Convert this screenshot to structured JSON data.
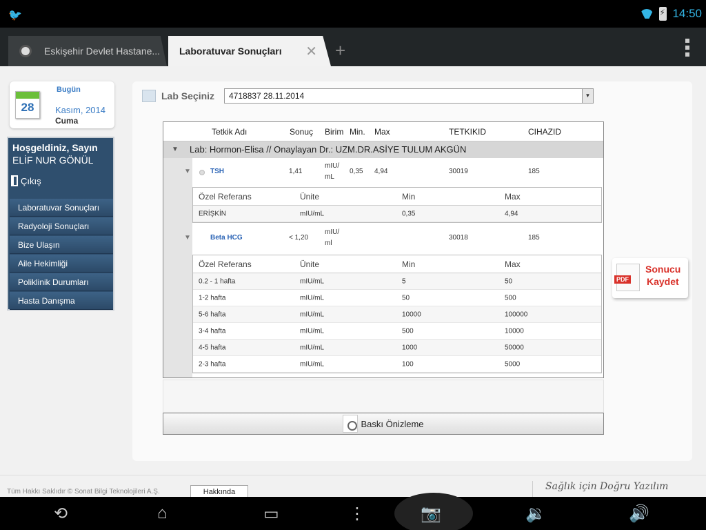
{
  "status": {
    "time": "14:50"
  },
  "browser": {
    "tabs": [
      {
        "label": "Eskişehir Devlet Hastane..."
      },
      {
        "label": "Laboratuvar Sonuçları"
      }
    ]
  },
  "date": {
    "today_label": "Bugün",
    "day_number": "28",
    "month_year": "Kasım, 2014",
    "weekday": "Cuma"
  },
  "sidebar": {
    "welcome": "Hoşgeldiniz, Sayın",
    "user": "ELİF NUR GÖNÜL",
    "logout": "Çıkış",
    "items": [
      {
        "label": "Laboratuvar Sonuçları"
      },
      {
        "label": "Radyoloji Sonuçları"
      },
      {
        "label": "Bize Ulaşın"
      },
      {
        "label": "Aile Hekimliği"
      },
      {
        "label": "Poliklinik Durumları"
      },
      {
        "label": "Hasta Danışma"
      }
    ]
  },
  "lab": {
    "select_label": "Lab Seçiniz",
    "selected": "4718837 28.11.2014"
  },
  "grid": {
    "headers": {
      "name": "Tetkik Adı",
      "result": "Sonuç",
      "unit": "Birim",
      "min": "Min.",
      "max": "Max",
      "id": "TETKIKID",
      "device": "CIHAZID"
    },
    "group": "Lab: Hormon-Elisa // Onaylayan Dr.: UZM.DR.ASİYE TULUM AKGÜN",
    "results": [
      {
        "name": "TSH",
        "result": "1,41",
        "unit1": "mIU/",
        "unit2": "mL",
        "min": "0,35",
        "max": "4,94",
        "id": "30019",
        "device": "185",
        "ref_headers": {
          "ref": "Özel Referans",
          "unit": "Ünite",
          "min": "Min",
          "max": "Max"
        },
        "refs": [
          {
            "ref": "ERİŞKİN",
            "unit": "mIU/mL",
            "min": "0,35",
            "max": "4,94"
          }
        ]
      },
      {
        "name": "Beta HCG",
        "result": "< 1,20",
        "unit1": "mIU/",
        "unit2": "ml",
        "min": "",
        "max": "",
        "id": "30018",
        "device": "185",
        "ref_headers": {
          "ref": "Özel Referans",
          "unit": "Ünite",
          "min": "Min",
          "max": "Max"
        },
        "refs": [
          {
            "ref": "0.2 - 1 hafta",
            "unit": "mIU/mL",
            "min": "5",
            "max": "50"
          },
          {
            "ref": "1-2 hafta",
            "unit": "mIU/mL",
            "min": "50",
            "max": "500"
          },
          {
            "ref": "5-6 hafta",
            "unit": "mIU/mL",
            "min": "10000",
            "max": "100000"
          },
          {
            "ref": "3-4 hafta",
            "unit": "mIU/mL",
            "min": "500",
            "max": "10000"
          },
          {
            "ref": "4-5 hafta",
            "unit": "mIU/mL",
            "min": "1000",
            "max": "50000"
          },
          {
            "ref": "2-3 hafta",
            "unit": "mIU/mL",
            "min": "100",
            "max": "5000"
          }
        ]
      }
    ]
  },
  "actions": {
    "print_preview": "Baskı Önizleme",
    "pdf_line1": "Sonucu",
    "pdf_line2": "Kaydet",
    "pdf_badge": "PDF"
  },
  "footer": {
    "copyright": "Tüm Hakkı Saklıdır © Sonat Bilgi Teknolojileri A.Ş.",
    "about": "Hakkında",
    "slogan": "Sağlık için Doğru Yazılım"
  }
}
